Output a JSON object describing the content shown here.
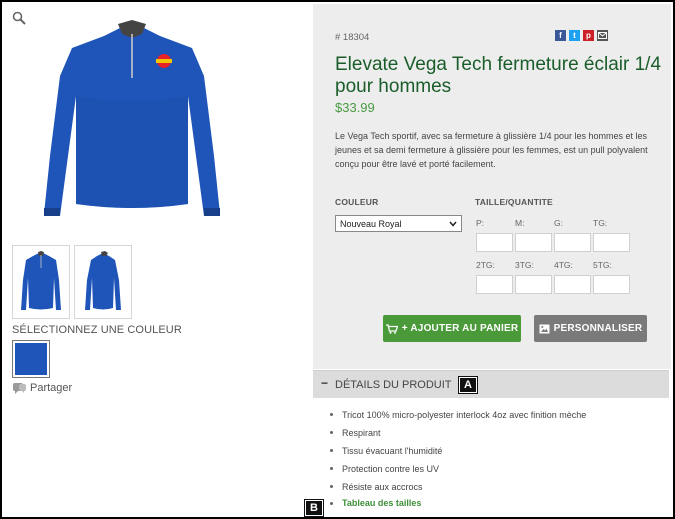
{
  "product": {
    "sku": "# 18304",
    "title": "Elevate Vega Tech fermeture éclair 1/4 pour hommes",
    "price": "$33.99",
    "description": "Le Vega Tech sportif, avec sa fermeture à glissière 1/4 pour les hommes et les jeunes et sa demi fermeture à glissière pour les femmes, est un pull polyvalent conçu pour être lavé et porté facilement."
  },
  "left": {
    "select_color_label": "SÉLECTIONNEZ UNE COULEUR",
    "share_label": "Partager",
    "swatch_color": "#1f55b8"
  },
  "options": {
    "color_label": "COULEUR",
    "color_value": "Nouveau Royal",
    "size_label": "TAILLE/QUANTITE",
    "sizes": [
      "P:",
      "M:",
      "G:",
      "TG:",
      "2TG:",
      "3TG:",
      "4TG:",
      "5TG:"
    ]
  },
  "buttons": {
    "add_to_cart": "+ AJOUTER AU PANIER",
    "customize": "PERSONNALISER"
  },
  "details": {
    "header": "DÉTAILS DU PRODUIT",
    "marker_a": "A",
    "marker_b": "B",
    "features": [
      "Tricot 100% micro-polyester interlock 4oz avec finition mèche",
      "Respirant",
      "Tissu évacuant l'humidité",
      "Protection contre les UV",
      "Résiste aux accrocs"
    ],
    "size_chart_link": "Tableau des tailles"
  },
  "colors": {
    "title_green": "#1a5d2a",
    "price_green": "#4a9a42",
    "cart_button": "#4a9a3a",
    "customize_button": "#7a7a7a",
    "jacket_blue": "#1f55b8"
  }
}
